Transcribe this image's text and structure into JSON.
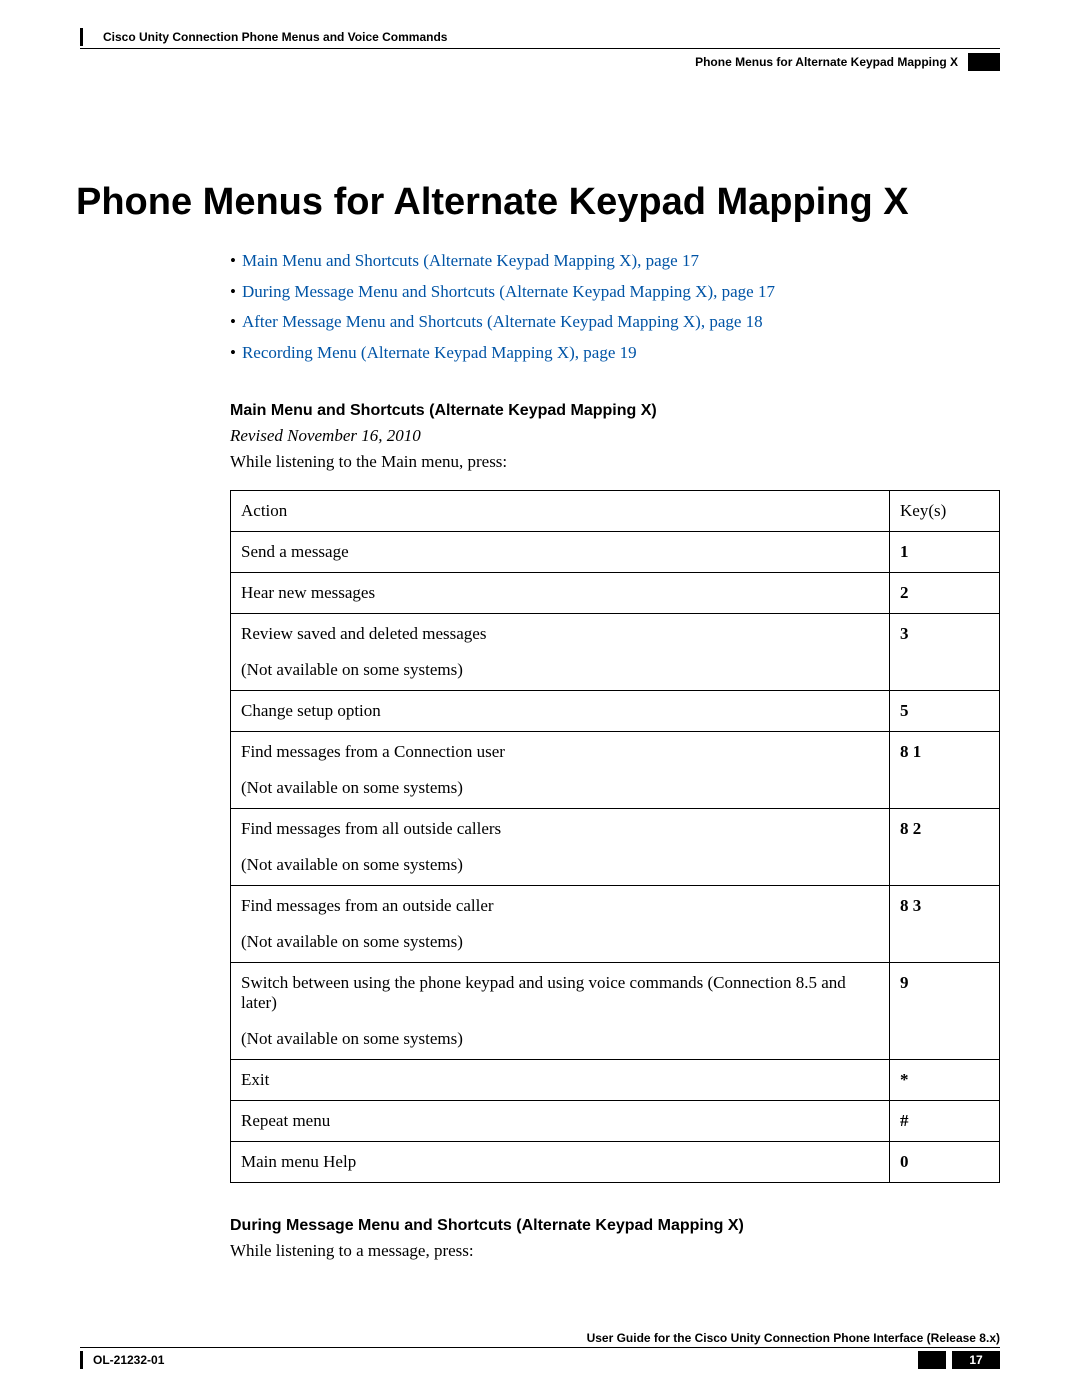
{
  "header": {
    "left": "Cisco Unity Connection Phone Menus and Voice Commands",
    "right": "Phone Menus for Alternate Keypad Mapping X"
  },
  "title": "Phone Menus for Alternate Keypad Mapping X",
  "toc": [
    "Main Menu and Shortcuts (Alternate Keypad Mapping X),  page 17",
    "During Message Menu and Shortcuts (Alternate Keypad Mapping X),  page 17",
    "After Message Menu and Shortcuts (Alternate Keypad Mapping X),  page 18",
    "Recording Menu (Alternate Keypad Mapping X),  page 19"
  ],
  "section1": {
    "heading": "Main Menu and Shortcuts (Alternate Keypad Mapping X)",
    "revised": "Revised November 16, 2010",
    "intro": "While listening to the Main menu, press:",
    "table_header": {
      "action": "Action",
      "key": "Key(s)"
    },
    "rows": [
      {
        "action": "Send a message",
        "note": "",
        "key": "1"
      },
      {
        "action": "Hear new messages",
        "note": "",
        "key": "2"
      },
      {
        "action": "Review saved and deleted messages",
        "note": "(Not available on some systems)",
        "key": "3"
      },
      {
        "action": "Change setup option",
        "note": "",
        "key": "5"
      },
      {
        "action": "Find messages from a Connection user",
        "note": "(Not available on some systems)",
        "key": "8 1"
      },
      {
        "action": "Find messages from all outside callers",
        "note": "(Not available on some systems)",
        "key": "8 2"
      },
      {
        "action": "Find messages from an outside caller",
        "note": "(Not available on some systems)",
        "key": "8 3"
      },
      {
        "action": "Switch between using the phone keypad and using voice commands (Connection 8.5 and later)",
        "note": "(Not available on some systems)",
        "key": "9"
      },
      {
        "action": "Exit",
        "note": "",
        "key": "*"
      },
      {
        "action": "Repeat menu",
        "note": "",
        "key": "#"
      },
      {
        "action": "Main menu Help",
        "note": "",
        "key": "0"
      }
    ]
  },
  "section2": {
    "heading": "During Message Menu and Shortcuts (Alternate Keypad Mapping X)",
    "intro": "While listening to a message, press:"
  },
  "footer": {
    "guide": "User Guide for the Cisco Unity Connection Phone Interface (Release 8.x)",
    "doc_id": "OL-21232-01",
    "page": "17"
  }
}
